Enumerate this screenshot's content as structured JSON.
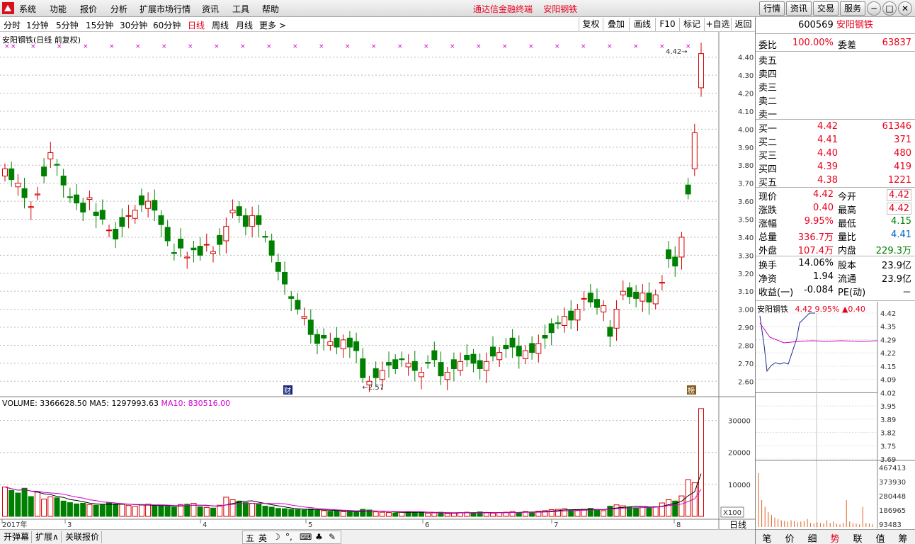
{
  "menu": {
    "items": [
      "系统",
      "功能",
      "报价",
      "分析",
      "扩展市场行情",
      "资讯",
      "工具",
      "帮助"
    ],
    "title": "通达信金融终端    安阳钢铁",
    "nav_buttons": [
      "行情",
      "资讯",
      "交易",
      "服务"
    ],
    "window_buttons": [
      "minimize-icon",
      "restore-icon",
      "close-icon"
    ]
  },
  "toolbar": {
    "periods": [
      "分时",
      "1分钟",
      "5分钟",
      "15分钟",
      "30分钟",
      "60分钟",
      "日线",
      "周线",
      "月线",
      "更多 >"
    ],
    "active_period": "日线",
    "tools": [
      "复权",
      "叠加",
      "画线",
      "F10",
      "标记",
      "+自选",
      "返回"
    ]
  },
  "chart": {
    "caption": "安阳钢铁(日线 前复权)",
    "price_axis": [
      "4.40",
      "4.30",
      "4.20",
      "4.10",
      "4.00",
      "3.90",
      "3.80",
      "3.70",
      "3.60",
      "3.50",
      "3.40",
      "3.30",
      "3.20",
      "3.10",
      "3.00",
      "2.90",
      "2.80",
      "2.70",
      "2.60"
    ],
    "low_marker": "2.57",
    "high_marker": "4.42",
    "event_marks": [
      "财",
      "榜"
    ],
    "volume_caption_prefix": "VOLUME: 3366628.50",
    "ma5_label": "MA5: 1297993.63",
    "ma10_label": "MA10: 830516.00",
    "volume_axis": [
      "30000",
      "20000",
      "10000"
    ],
    "volume_unit": "X100",
    "date_labels": [
      "2017年",
      "3",
      "4",
      "5",
      "6",
      "7",
      "8"
    ],
    "period_label": "日线"
  },
  "chart_data": {
    "type": "candlestick",
    "title": "安阳钢铁(日线 前复权)",
    "ylim": [
      2.55,
      4.45
    ],
    "series": [
      {
        "name": "VOLUME",
        "last_value": 3366628.5
      },
      {
        "name": "MA5",
        "last_value": 1297993.63
      },
      {
        "name": "MA10",
        "last_value": 830516.0
      }
    ],
    "closes": [
      3.78,
      3.72,
      3.7,
      3.62,
      3.57,
      3.64,
      3.74,
      3.87,
      3.8,
      3.69,
      3.62,
      3.59,
      3.54,
      3.62,
      3.52,
      3.5,
      3.44,
      3.39,
      3.46,
      3.52,
      3.55,
      3.58,
      3.6,
      3.55,
      3.47,
      3.38,
      3.31,
      3.34,
      3.29,
      3.33,
      3.3,
      3.36,
      3.32,
      3.36,
      3.46,
      3.55,
      3.52,
      3.46,
      3.52,
      3.47,
      3.4,
      3.3,
      3.21,
      3.14,
      3.06,
      3.0,
      2.96,
      2.86,
      2.81,
      2.84,
      2.82,
      2.79,
      2.83,
      2.79,
      2.77,
      2.62,
      2.6,
      2.62,
      2.66,
      2.69,
      2.67,
      2.72,
      2.7,
      2.66,
      2.65,
      2.7,
      2.72,
      2.63,
      2.65,
      2.67,
      2.71,
      2.72,
      2.7,
      2.67,
      2.71,
      2.74,
      2.76,
      2.78,
      2.79,
      2.74,
      2.77,
      2.76,
      2.81,
      2.84,
      2.87,
      2.92,
      2.96,
      2.94,
      3.0,
      3.06,
      3.04,
      3.01,
      3.02,
      2.85,
      3.0,
      3.1,
      3.07,
      3.06,
      3.09,
      3.04,
      3.08,
      3.15,
      3.28,
      3.24,
      3.4,
      3.64,
      3.98,
      4.42
    ],
    "volume_ylim": [
      0,
      35000
    ],
    "volumes": [
      9200,
      8100,
      7300,
      8800,
      6200,
      7600,
      5400,
      6100,
      5800,
      4800,
      4300,
      3900,
      4100,
      3700,
      3500,
      3600,
      4200,
      3900,
      3800,
      3400,
      3100,
      3600,
      3800,
      3300,
      3200,
      3100,
      2900,
      3700,
      3800,
      4100,
      3000,
      2800,
      2600,
      3500,
      6000,
      5200,
      4800,
      4300,
      4100,
      3800,
      3200,
      2900,
      2500,
      2400,
      2200,
      2100,
      2000,
      2300,
      1900,
      1800,
      1600,
      1700,
      1500,
      1400,
      1300,
      2200,
      2000,
      1400,
      1300,
      1200,
      1100,
      1300,
      1500,
      1400,
      1200,
      1000,
      1100,
      1300,
      900,
      1000,
      1200,
      1300,
      1200,
      1400,
      1100,
      1000,
      1200,
      1300,
      1500,
      1200,
      1500,
      1300,
      1600,
      1800,
      2100,
      2200,
      2400,
      1900,
      2000,
      2200,
      2500,
      2100,
      1800,
      3200,
      3600,
      3300,
      2900,
      2700,
      3100,
      2800,
      3000,
      4200,
      5200,
      4800,
      6400,
      11500,
      10500,
      33700
    ]
  },
  "quote": {
    "code": "600569",
    "name": "安阳钢铁",
    "weibi_label": "委比",
    "weibi_value": "100.00%",
    "weicha_label": "委差",
    "weicha_value": "63837",
    "sell": [
      {
        "label": "卖五",
        "price": "",
        "vol": ""
      },
      {
        "label": "卖四",
        "price": "",
        "vol": ""
      },
      {
        "label": "卖三",
        "price": "",
        "vol": ""
      },
      {
        "label": "卖二",
        "price": "",
        "vol": ""
      },
      {
        "label": "卖一",
        "price": "",
        "vol": ""
      }
    ],
    "buy": [
      {
        "label": "买一",
        "price": "4.42",
        "vol": "61346"
      },
      {
        "label": "买二",
        "price": "4.41",
        "vol": "371"
      },
      {
        "label": "买三",
        "price": "4.40",
        "vol": "480"
      },
      {
        "label": "买四",
        "price": "4.39",
        "vol": "419"
      },
      {
        "label": "买五",
        "price": "4.38",
        "vol": "1221"
      }
    ],
    "stats": [
      {
        "l1": "现价",
        "v1": "4.42",
        "l2": "今开",
        "v2": "4.42"
      },
      {
        "l1": "涨跌",
        "v1": "0.40",
        "l2": "最高",
        "v2": "4.42"
      },
      {
        "l1": "涨幅",
        "v1": "9.95%",
        "l2": "最低",
        "v2": "4.15"
      },
      {
        "l1": "总量",
        "v1": "336.7万",
        "l2": "量比",
        "v2": "4.41"
      },
      {
        "l1": "外盘",
        "v1": "107.4万",
        "l2": "内盘",
        "v2": "229.3万"
      }
    ],
    "fundamentals": [
      {
        "l1": "换手",
        "v1": "14.06%",
        "l2": "股本",
        "v2": "23.9亿"
      },
      {
        "l1": "净资",
        "v1": "1.94",
        "l2": "流通",
        "v2": "23.9亿"
      },
      {
        "l1": "收益(一)",
        "v1": "-0.084",
        "l2": "PE(动)",
        "v2": "－"
      }
    ]
  },
  "mini": {
    "name": "安阳钢铁",
    "price": "4.42",
    "pct": "9.95%",
    "chg": "▲0.40",
    "price_axis": [
      "4.42",
      "4.35",
      "4.29",
      "4.22",
      "4.15",
      "4.09",
      "4.02",
      "3.95",
      "3.89",
      "3.82",
      "3.75",
      "3.69"
    ],
    "volume_axis": [
      "467413",
      "373930",
      "280448",
      "186965",
      "93483"
    ]
  },
  "bottom": {
    "buttons": [
      "开弹幕",
      "扩展∧",
      "关联报价"
    ],
    "ime": [
      "五",
      "英",
      "☽",
      "°,",
      "⌨",
      "♣",
      "✎"
    ]
  },
  "tabs": [
    "笔",
    "价",
    "细",
    "势",
    "联",
    "值",
    "筹"
  ],
  "active_tab": "势"
}
